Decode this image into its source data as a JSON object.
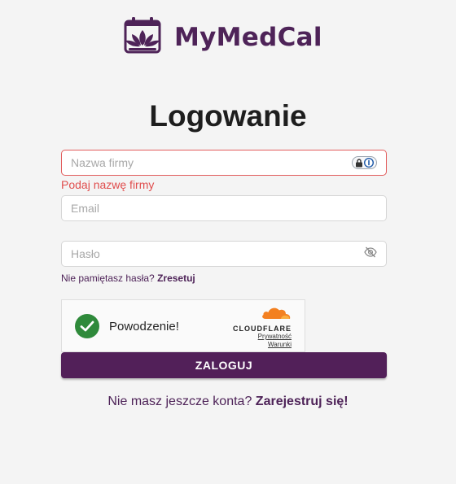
{
  "app": {
    "name": "MyMedCal",
    "brand_color": "#4e2358",
    "logo_icon": "calendar-lotus-icon"
  },
  "page": {
    "title": "Logowanie"
  },
  "form": {
    "company": {
      "placeholder": "Nazwa firmy",
      "value": "",
      "error": "Podaj nazwę firmy",
      "addon_icon": "password-manager-icon"
    },
    "email": {
      "placeholder": "Email",
      "value": ""
    },
    "password": {
      "placeholder": "Hasło",
      "value": "",
      "toggle_icon": "eye-off-icon"
    },
    "forgot_text": "Nie pamiętasz hasła?",
    "forgot_link": "Zresetuj",
    "submit_label": "ZALOGUJ",
    "submit_color": "#522059"
  },
  "captcha": {
    "status": "Powodzenie!",
    "provider": "CLOUDFLARE",
    "privacy_link": "Prywatność",
    "terms_link": "Warunki",
    "success_color": "#2f8a3b"
  },
  "register": {
    "text": "Nie masz jeszcze konta?",
    "link": "Zarejestruj się!"
  },
  "colors": {
    "error": "#e04d4d",
    "cloudflare_orange": "#f38020"
  }
}
